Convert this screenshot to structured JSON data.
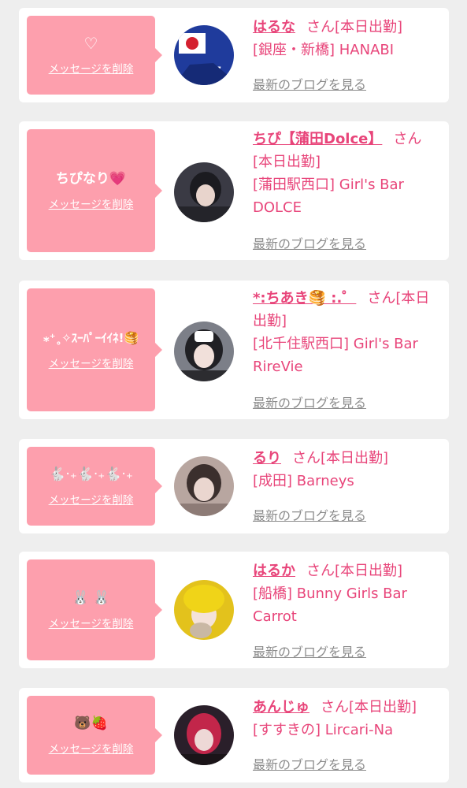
{
  "delete_label": "メッセージを削除",
  "blog_label": "最新のブログを見る",
  "cards": [
    {
      "message": "♡",
      "name": "はるな",
      "suffix": "さん[本日出勤]",
      "store": "[銀座・新橋] HANABI"
    },
    {
      "message": "ちぴなり💗",
      "name": "ちぴ【蒲田Dolce】",
      "suffix": "さん",
      "status": "[本日出勤]",
      "store": "[蒲田駅西口] Girl's Bar DOLCE"
    },
    {
      "message": "⁎⁺˳✧ｽｰﾊﾟｰｲｲﾈ!🥞",
      "name": "*:ちあき🥞 :.゜",
      "suffix": "さん[本日出勤]",
      "store": "[北千住駅西口] Girl's Bar RireVie"
    },
    {
      "message": "🐇‧₊🐇‧₊🐇‧₊",
      "name": "るり",
      "suffix": "さん[本日出勤]",
      "store": "[成田] Barneys"
    },
    {
      "message": "🐰 🐰",
      "name": "はるか",
      "suffix": "さん[本日出勤]",
      "store": "[船橋] Bunny Girls Bar Carrot"
    },
    {
      "message": "🐻🍓",
      "name": "あんじゅ",
      "suffix": "さん[本日出勤]",
      "store": "[すすきの] Lircari-Na"
    }
  ],
  "colors": {
    "page_bg": "#eeeeee",
    "card_bg": "#ffffff",
    "bubble_bg": "#fd9fad",
    "accent_text": "#e8457a",
    "blog_link": "#8c8c8c"
  }
}
